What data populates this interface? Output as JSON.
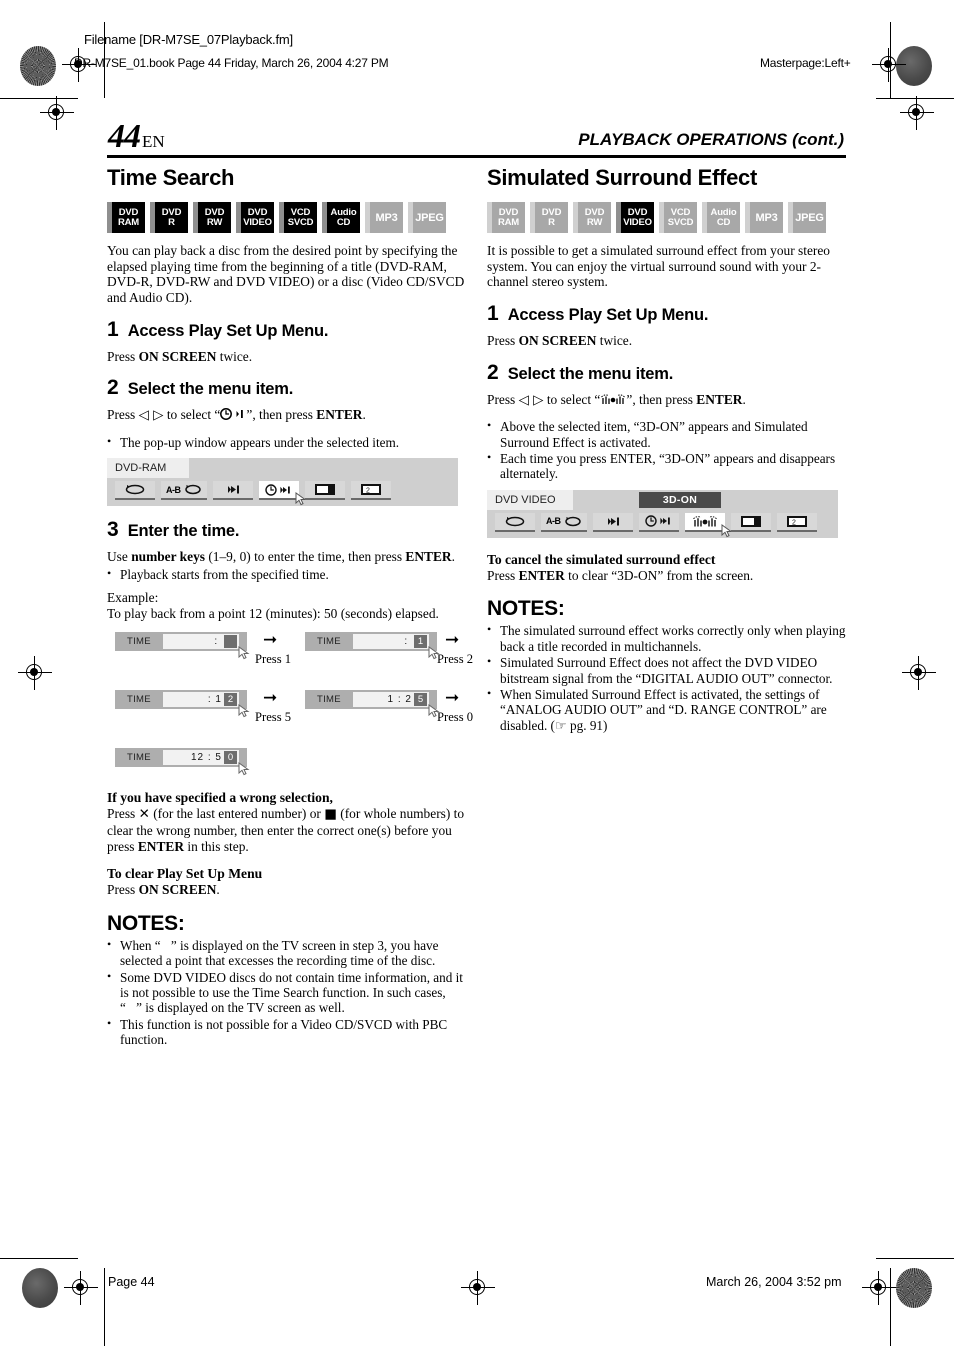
{
  "crop_header": {
    "filename_line": "Filename [DR-M7SE_07Playback.fm]",
    "book_line": "DR-M7SE_01.book  Page 44  Friday, March 26, 2004  4:27 PM",
    "masterpage": "Masterpage:Left+"
  },
  "page_head": {
    "folio_number": "44",
    "folio_lang": "EN",
    "running_head": "PLAYBACK OPERATIONS (cont.)"
  },
  "left_column": {
    "section_title": "Time Search",
    "badges": [
      {
        "l1": "DVD",
        "l2": "RAM",
        "state": "on"
      },
      {
        "l1": "DVD",
        "l2": "R",
        "state": "on"
      },
      {
        "l1": "DVD",
        "l2": "RW",
        "state": "on"
      },
      {
        "l1": "DVD",
        "l2": "VIDEO",
        "state": "on"
      },
      {
        "l1": "VCD",
        "l2": "SVCD",
        "state": "on"
      },
      {
        "l1": "Audio",
        "l2": "CD",
        "state": "on"
      },
      {
        "l1": "MP3",
        "l2": "",
        "state": "off"
      },
      {
        "l1": "JPEG",
        "l2": "",
        "state": "off"
      }
    ],
    "intro": "You can play back a disc from the desired point by specifying the elapsed playing time from the beginning of a title (DVD-RAM, DVD-R, DVD-RW and DVD VIDEO) or a disc (Video CD/SVCD and Audio CD).",
    "step1_number": "1",
    "step1_title": "Access Play Set Up Menu.",
    "step1_body_pre": "Press ",
    "step1_body_bold": "ON SCREEN",
    "step1_body_post": " twice.",
    "step2_number": "2",
    "step2_title": "Select the menu item.",
    "step2_pre": "Press ",
    "step2_arrows": "◁ ▷",
    "step2_mid": " to select “",
    "step2_icon": "◔➜|",
    "step2_post": "”, then press ",
    "step2_bold": "ENTER",
    "step2_end": ".",
    "step2_bullet": "The pop-up window appears under the selected item.",
    "osd": {
      "disc_tag": "DVD-RAM",
      "selected_index": 3,
      "buttons": [
        "repeat-icon",
        "ab-repeat-icon",
        "skip-icon",
        "time-search-icon",
        "screen-icon",
        "subtitle-icon"
      ],
      "ab_label": "A-B"
    },
    "step3_number": "3",
    "step3_title": "Enter the time.",
    "step3_pre": "Use ",
    "step3_bold": "number keys",
    "step3_mid": " (1–9, 0) to enter the time, then press ",
    "step3_bold2": "ENTER",
    "step3_end": ".",
    "step3_bullet": "Playback starts from the specified time.",
    "example_label": "Example:",
    "example_text": "To play back from a point 12 (minutes): 50 (seconds) elapsed.",
    "time_sequence": [
      {
        "label": "TIME",
        "digits": "   : ",
        "caret": "",
        "press": "Press 1"
      },
      {
        "label": "TIME",
        "digits": "   : ",
        "caret": "1",
        "press": "Press 2"
      },
      {
        "label": "TIME",
        "digits": "  : 1",
        "caret": "2",
        "press": "Press 5"
      },
      {
        "label": "TIME",
        "digits": "1 : 2",
        "caret": "5",
        "press": "Press 0"
      },
      {
        "label": "TIME",
        "digits": "12 : 5",
        "caret": "0",
        "press": ""
      }
    ],
    "wrong_heading": "If you have specified a wrong selection,",
    "wrong_body_1": "Press ",
    "wrong_sym_1": "✕",
    "wrong_body_2": " (for the last entered number) or ",
    "wrong_sym_2": "■",
    "wrong_body_3": " (for whole numbers) to clear the wrong number, then enter the correct one(s) before you press ",
    "wrong_bold": "ENTER",
    "wrong_body_4": " in this step.",
    "clear_heading": "To clear Play Set Up Menu",
    "clear_pre": "Press ",
    "clear_bold": "ON SCREEN",
    "clear_post": ".",
    "notes_heading": "NOTES:",
    "notes": [
      "When “⃠” is displayed on the TV screen in step 3, you have selected a point that excesses the recording time of the disc.",
      "Some DVD VIDEO discs do not contain time information, and it is not possible to use the Time Search function. In such cases, “⃠” is displayed on the TV screen as well.",
      "This function is not possible for a Video CD/SVCD with PBC function."
    ]
  },
  "right_column": {
    "section_title": "Simulated Surround Effect",
    "badges": [
      {
        "l1": "DVD",
        "l2": "RAM",
        "state": "off"
      },
      {
        "l1": "DVD",
        "l2": "R",
        "state": "off"
      },
      {
        "l1": "DVD",
        "l2": "RW",
        "state": "off"
      },
      {
        "l1": "DVD",
        "l2": "VIDEO",
        "state": "on"
      },
      {
        "l1": "VCD",
        "l2": "SVCD",
        "state": "off"
      },
      {
        "l1": "Audio",
        "l2": "CD",
        "state": "off"
      },
      {
        "l1": "MP3",
        "l2": "",
        "state": "off"
      },
      {
        "l1": "JPEG",
        "l2": "",
        "state": "off"
      }
    ],
    "intro": "It is possible to get a simulated surround effect from your stereo system. You can enjoy the virtual surround sound with your 2-channel stereo system.",
    "step1_number": "1",
    "step1_title": "Access Play Set Up Menu.",
    "step1_body_pre": "Press ",
    "step1_body_bold": "ON SCREEN",
    "step1_body_post": " twice.",
    "step2_number": "2",
    "step2_title": "Select the menu item.",
    "step2_pre": "Press ",
    "step2_arrows": "◁ ▷",
    "step2_mid": " to select “",
    "step2_icon": "surround-icon",
    "step2_post": "”, then press ",
    "step2_bold": "ENTER",
    "step2_end": ".",
    "step2_bullets": [
      "Above the selected item, “3D-ON” appears and Simulated Surround Effect is activated.",
      "Each time you press ENTER, “3D-ON” appears and disappears alternately."
    ],
    "osd": {
      "disc_tag": "DVD VIDEO",
      "flag": "3D-ON",
      "selected_index": 4,
      "ab_label": "A-B"
    },
    "cancel_heading": "To cancel the simulated surround effect",
    "cancel_pre": "Press ",
    "cancel_bold": "ENTER",
    "cancel_post": " to clear “3D-ON” from the screen.",
    "notes_heading": "NOTES:",
    "notes": [
      "The simulated surround effect works correctly only when playing back a title recorded in multichannels.",
      "Simulated Surround Effect does not affect the DVD VIDEO bitstream signal from the “DIGITAL AUDIO OUT” connector.",
      "When Simulated Surround Effect is activated, the settings of “ANALOG AUDIO OUT” and “D. RANGE CONTROL” are disabled. (☞ pg. 91)"
    ]
  },
  "footer": {
    "page_label": "Page 44",
    "timestamp": "March 26, 2004 3:52 pm"
  }
}
